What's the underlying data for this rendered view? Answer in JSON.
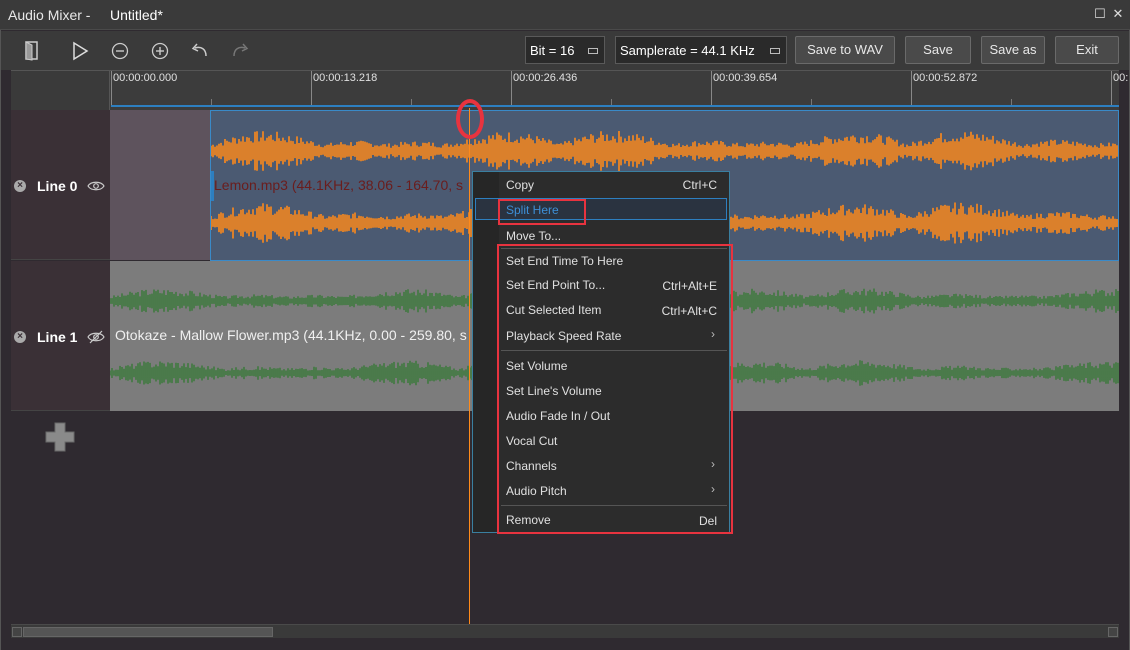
{
  "window": {
    "app_title": "Audio Mixer -",
    "doc_title": "Untitled*",
    "max_glyph": "☐",
    "close_glyph": "✕"
  },
  "toolbar": {
    "icons": [
      "door-exit-icon",
      "play-icon",
      "zoom-out-icon",
      "zoom-in-icon",
      "undo-icon",
      "redo-icon"
    ],
    "bit_label": "Bit = 16",
    "samplerate_label": "Samplerate = 44.1 KHz",
    "save_wav": "Save to WAV",
    "save": "Save",
    "save_as": "Save as",
    "exit": "Exit"
  },
  "ruler": {
    "ticks": [
      "00:00:00.000",
      "00:00:13.218",
      "00:00:26.436",
      "00:00:39.654",
      "00:00:52.872",
      "00:"
    ]
  },
  "tracks": [
    {
      "name": "Line 0",
      "remove_glyph": "×",
      "visible": true,
      "clip_label": "Lemon.mp3  (44.1KHz, 38.06 - 164.70, s",
      "wave_color": "#ff8a1a",
      "clip_bg": "#4b5a72"
    },
    {
      "name": "Line 1",
      "remove_glyph": "×",
      "visible": false,
      "clip_label": "Otokaze - Mallow Flower.mp3  (44.1KHz, 0.00 - 259.80, s",
      "wave_color": "#3f7a3f",
      "clip_bg": "#7c7c7c"
    }
  ],
  "add_track_icon": "plus-icon",
  "context_menu": {
    "items": [
      {
        "label": "Copy",
        "shortcut": "Ctrl+C"
      },
      {
        "label": "Split Here",
        "shortcut": ""
      },
      {
        "label": "Move To...",
        "shortcut": ""
      },
      {
        "label": "Set End Time To Here",
        "shortcut": ""
      },
      {
        "label": "Set End Point To...",
        "shortcut": "Ctrl+Alt+E"
      },
      {
        "label": "Cut Selected Item",
        "shortcut": "Ctrl+Alt+C"
      },
      {
        "label": "Playback Speed Rate",
        "shortcut": "",
        "submenu_glyph": "›"
      },
      {
        "label": "Set Volume",
        "shortcut": ""
      },
      {
        "label": "Set Line's Volume",
        "shortcut": ""
      },
      {
        "label": "Audio Fade In / Out",
        "shortcut": ""
      },
      {
        "label": "Vocal Cut",
        "shortcut": ""
      },
      {
        "label": "Channels",
        "shortcut": "",
        "submenu_glyph": "›"
      },
      {
        "label": "Audio Pitch",
        "shortcut": "",
        "submenu_glyph": "›"
      },
      {
        "label": "Remove",
        "shortcut": "Del"
      }
    ]
  },
  "colors": {
    "accent_blue": "#2d7fc0",
    "highlight_red": "#e8333f",
    "playhead": "#ff8a1a"
  }
}
